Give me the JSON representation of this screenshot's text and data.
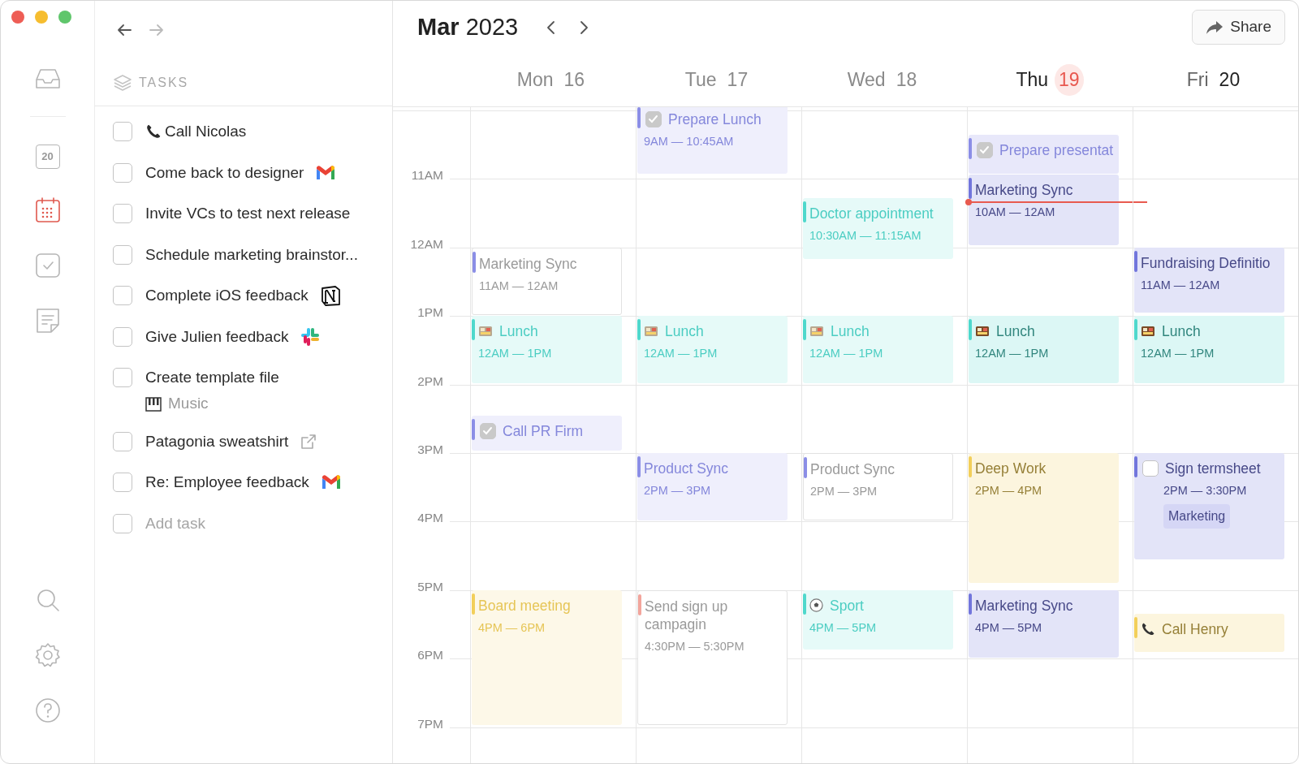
{
  "calendar": {
    "month": "Mar",
    "year": "2023",
    "share_label": "Share",
    "hours": [
      "11AM",
      "12AM",
      "1PM",
      "2PM",
      "3PM",
      "4PM",
      "5PM",
      "6PM",
      "7PM"
    ],
    "days": [
      {
        "name": "Mon",
        "date": "16",
        "past": true,
        "today": false,
        "events": [
          {
            "title": "Marketing Sync",
            "time": "11AM — 12AM",
            "color": "#8b8ee6",
            "kind": "event",
            "outlined": true
          },
          {
            "title": "Lunch",
            "time": "12AM — 1PM",
            "color": "#4fd8cc",
            "kind": "meal",
            "outlined": false
          },
          {
            "title": "Call PR Firm",
            "color": "#8b8ee6",
            "kind": "task",
            "checked": true,
            "outlined": false
          },
          {
            "title": "Board meeting",
            "time": "4PM — 6PM",
            "color": "#f2cf5b",
            "kind": "event",
            "outlined": false
          }
        ]
      },
      {
        "name": "Tue",
        "date": "17",
        "past": true,
        "today": false,
        "events": [
          {
            "title": "Prepare Lunch",
            "time": "9AM — 10:45AM",
            "color": "#8b8ee6",
            "kind": "task",
            "checked": true,
            "outlined": false
          },
          {
            "title": "Lunch",
            "time": "12AM — 1PM",
            "color": "#4fd8cc",
            "kind": "meal",
            "outlined": false
          },
          {
            "title": "Product Sync",
            "time": "2PM — 3PM",
            "color": "#8b8ee6",
            "kind": "event",
            "outlined": false
          },
          {
            "title": "Send sign up campagin",
            "time": "4:30PM — 5:30PM",
            "color": "#f3a59c",
            "kind": "event",
            "outlined": true
          }
        ]
      },
      {
        "name": "Wed",
        "date": "18",
        "past": true,
        "today": false,
        "events": [
          {
            "title": "Doctor appointment",
            "time": "10:30AM — 11:15AM",
            "color": "#4fd8cc",
            "kind": "event",
            "outlined": false
          },
          {
            "title": "Lunch",
            "time": "12AM — 1PM",
            "color": "#4fd8cc",
            "kind": "meal",
            "outlined": false
          },
          {
            "title": "Product Sync",
            "time": "2PM — 3PM",
            "color": "#8b8ee6",
            "kind": "event",
            "outlined": true
          },
          {
            "title": "Sport",
            "time": "4PM — 5PM",
            "color": "#4fd8cc",
            "kind": "sport",
            "outlined": false
          }
        ]
      },
      {
        "name": "Thu",
        "date": "19",
        "past": false,
        "today": true,
        "events": [
          {
            "title": "Prepare presentat",
            "color": "#8b8ee6",
            "kind": "task",
            "checked": true,
            "outlined": false
          },
          {
            "title": "Marketing Sync",
            "time": "10AM — 12AM",
            "color": "#7276dc",
            "kind": "event",
            "outlined": false
          },
          {
            "title": "Lunch",
            "time": "12AM — 1PM",
            "color": "#4fd8cc",
            "kind": "meal",
            "outlined": false
          },
          {
            "title": "Deep Work",
            "time": "2PM — 4PM",
            "color": "#f2cf5b",
            "kind": "event",
            "outlined": false
          },
          {
            "title": "Marketing Sync",
            "time": "4PM — 5PM",
            "color": "#7276dc",
            "kind": "event",
            "outlined": false
          }
        ]
      },
      {
        "name": "Fri",
        "date": "20",
        "past": false,
        "today": false,
        "events": [
          {
            "title": "Fundraising Definitio",
            "time": "11AM — 12AM",
            "color": "#7276dc",
            "kind": "event",
            "outlined": false
          },
          {
            "title": "Lunch",
            "time": "12AM — 1PM",
            "color": "#4fd8cc",
            "kind": "meal",
            "outlined": false
          },
          {
            "title": "Sign termsheet",
            "time": "2PM — 3:30PM",
            "tag": "Marketing",
            "color": "#7276dc",
            "kind": "task",
            "checked": false,
            "outlined": false
          },
          {
            "title": "Call Henry",
            "color": "#f2cf5b",
            "kind": "call",
            "outlined": false
          }
        ]
      }
    ]
  },
  "tasks": {
    "title": "TASKS",
    "items": [
      {
        "label": "Call Nicolas",
        "kind": "call",
        "checked": false
      },
      {
        "label": "Come back to designer",
        "kind": "mail",
        "checked": false
      },
      {
        "label": "Invite VCs to test next release",
        "kind": "plain",
        "checked": false
      },
      {
        "label": "Schedule marketing brainstor...",
        "kind": "plain",
        "checked": false
      },
      {
        "label": "Complete iOS feedback",
        "kind": "doc",
        "checked": false
      },
      {
        "label": "Give Julien feedback",
        "kind": "chat",
        "checked": false
      },
      {
        "label": "Create template file",
        "kind": "plain",
        "checked": false,
        "project": "Music"
      },
      {
        "label": "Patagonia sweatshirt",
        "kind": "link",
        "checked": false
      },
      {
        "label": "Re: Employee feedback",
        "kind": "mail",
        "checked": false
      }
    ],
    "add_task": {
      "placeholder": "Add task",
      "checked": false
    }
  },
  "rail": {
    "items": [
      {
        "kind": "inbox",
        "selected": false
      },
      {
        "kind": "day",
        "label": "20",
        "selected": false
      },
      {
        "kind": "week",
        "selected": true
      },
      {
        "kind": "tasks",
        "selected": false
      },
      {
        "kind": "notes",
        "selected": false
      }
    ]
  }
}
